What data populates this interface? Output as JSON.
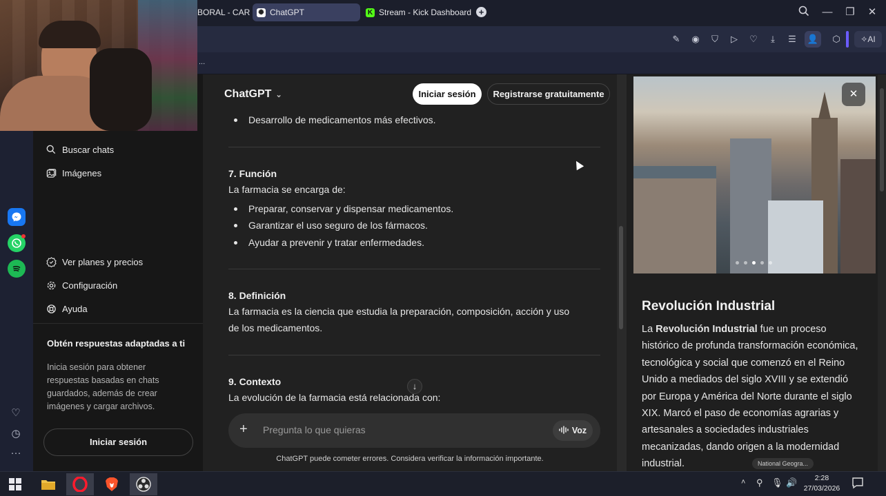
{
  "browser": {
    "tabs": [
      {
        "label": "BORAL - CARG",
        "active": false
      },
      {
        "label": "ChatGPT",
        "active": true
      },
      {
        "label": "Stream - Kick Dashboard",
        "active": false
      }
    ],
    "new_tab": "+",
    "ai_label": "AI",
    "bookmarks_more": "..."
  },
  "sidebar": {
    "items": [
      {
        "label": "Buscar chats",
        "icon": "search-icon"
      },
      {
        "label": "Imágenes",
        "icon": "images-icon"
      }
    ],
    "bottom_items": [
      {
        "label": "Ver planes y precios",
        "icon": "plans-icon"
      },
      {
        "label": "Configuración",
        "icon": "gear-icon"
      },
      {
        "label": "Ayuda",
        "icon": "help-icon"
      }
    ],
    "promo_title": "Obtén respuestas adaptadas a ti",
    "promo_text": "Inicia sesión para obtener respuestas basadas en chats guardados, además de crear imágenes y cargar archivos.",
    "login_button": "Iniciar sesión"
  },
  "header": {
    "model": "ChatGPT",
    "login": "Iniciar sesión",
    "signup": "Registrarse gratuitamente"
  },
  "chat": {
    "top_bullet": "Desarrollo de medicamentos más efectivos.",
    "s7_title": "7. Función",
    "s7_intro": "La farmacia se encarga de:",
    "s7_bullets": [
      "Preparar, conservar y dispensar medicamentos.",
      "Garantizar el uso seguro de los fármacos.",
      "Ayudar a prevenir y tratar enfermedades."
    ],
    "s8_title": "8. Definición",
    "s8_text_line1": "La farmacia es la ciencia que estudia la preparación, composición, acción y uso",
    "s8_text_line2": "de los medicamentos.",
    "s9_title": "9. Contexto",
    "s9_text": "La evolución de la farmacia está relacionada con:",
    "input_placeholder": "Pregunta lo que quieras",
    "voice_label": "Voz",
    "disclaimer": "ChatGPT puede cometer errores. Considera verificar la información importante."
  },
  "panel": {
    "title": "Revolución Industrial",
    "text_bold": "Revolución Industrial",
    "text_pre": "La ",
    "text_rest": " fue un proceso histórico de profunda transformación económica, tecnológica y social que comenzó en el Reino Unido a mediados del siglo XVIII y se extendió por Europa y América del Norte durante el siglo XIX. Marcó el paso de economías agrarias y artesanales a sociedades industriales mecanizadas, dando origen a la modernidad industrial.",
    "source": "National Geogra...",
    "close": "✕",
    "carousel_dots": 5,
    "carousel_active": 3
  },
  "taskbar": {
    "time": "2:28",
    "date": "27/03/2026"
  },
  "colors": {
    "whatsapp": "#25d366",
    "spotify": "#1db954",
    "messenger": "#1877f2",
    "kick": "#53fc18",
    "accent_tab": "#3a4060"
  }
}
